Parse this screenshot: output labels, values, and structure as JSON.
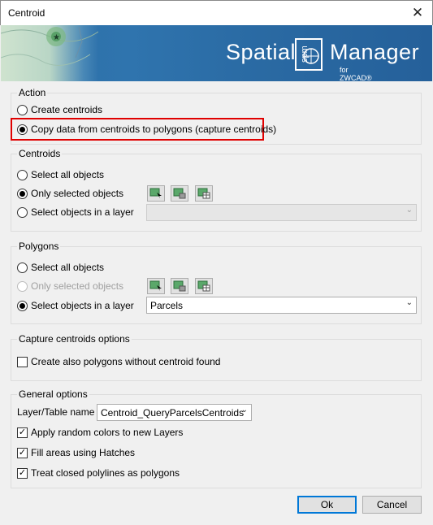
{
  "window": {
    "title": "Centroid",
    "close_glyph": "✕"
  },
  "banner": {
    "brand_left": "Spatial",
    "logo_text": "spm",
    "brand_right": "Manager",
    "brand_sub": "for ZWCAD®"
  },
  "action": {
    "title": "Action",
    "create_centroids": "Create centroids",
    "copy_data": "Copy data from centroids to polygons (capture centroids)",
    "selected": "copy_data"
  },
  "centroids": {
    "title": "Centroids",
    "select_all": "Select all objects",
    "only_selected": "Only selected objects",
    "select_layer": "Select objects in a layer",
    "selected": "only_selected",
    "layer_value": "",
    "buttons": [
      "select-objects-icon",
      "add-objects-icon",
      "table-select-icon"
    ]
  },
  "polygons": {
    "title": "Polygons",
    "select_all": "Select all objects",
    "only_selected": "Only selected objects",
    "select_layer": "Select objects in a layer",
    "selected": "select_layer",
    "layer_value": "Parcels",
    "buttons": [
      "select-objects-icon",
      "add-objects-icon",
      "table-select-icon"
    ]
  },
  "capture_options": {
    "title": "Capture centroids options",
    "create_without_centroid": "Create also polygons without centroid found",
    "create_without_centroid_checked": false
  },
  "general": {
    "title": "General options",
    "layer_label": "Layer/Table name",
    "layer_value": "Centroid_QueryParcelsCentroids",
    "random_colors": "Apply random colors to new Layers",
    "random_colors_checked": true,
    "fill_hatches": "Fill areas using Hatches",
    "fill_hatches_checked": true,
    "closed_polylines": "Treat closed polylines as polygons",
    "closed_polylines_checked": true
  },
  "footer": {
    "ok": "Ok",
    "cancel": "Cancel"
  },
  "colors": {
    "accent": "#0078d7",
    "highlight": "#e00000",
    "banner": "#2d6fa6"
  }
}
